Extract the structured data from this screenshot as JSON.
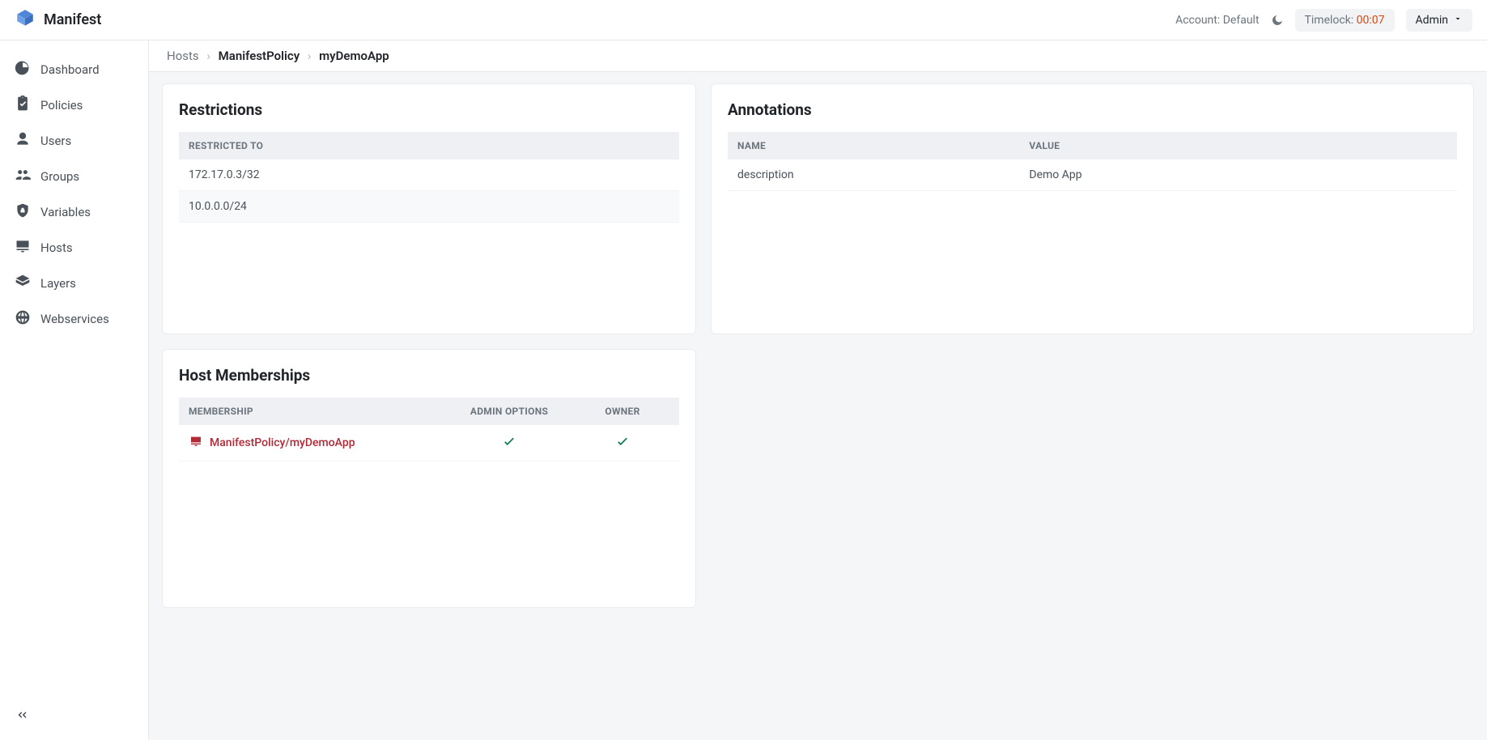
{
  "brand": "Manifest",
  "header": {
    "account_label": "Account: Default",
    "timelock_label": "Timelock: ",
    "timelock_value": "00:07",
    "user_label": "Admin"
  },
  "sidebar": {
    "items": [
      {
        "label": "Dashboard"
      },
      {
        "label": "Policies"
      },
      {
        "label": "Users"
      },
      {
        "label": "Groups"
      },
      {
        "label": "Variables"
      },
      {
        "label": "Hosts"
      },
      {
        "label": "Layers"
      },
      {
        "label": "Webservices"
      }
    ]
  },
  "breadcrumb": {
    "root": "Hosts",
    "mid": "ManifestPolicy",
    "leaf": "myDemoApp"
  },
  "restrictions": {
    "title": "Restrictions",
    "col": "RESTRICTED TO",
    "rows": [
      "172.17.0.3/32",
      "10.0.0.0/24"
    ]
  },
  "annotations": {
    "title": "Annotations",
    "cols": [
      "NAME",
      "VALUE"
    ],
    "rows": [
      {
        "name": "description",
        "value": "Demo App"
      }
    ]
  },
  "memberships": {
    "title": "Host Memberships",
    "cols": [
      "MEMBERSHIP",
      "ADMIN OPTIONS",
      "OWNER"
    ],
    "rows": [
      {
        "label": "ManifestPolicy/myDemoApp",
        "admin": true,
        "owner": true
      }
    ]
  }
}
